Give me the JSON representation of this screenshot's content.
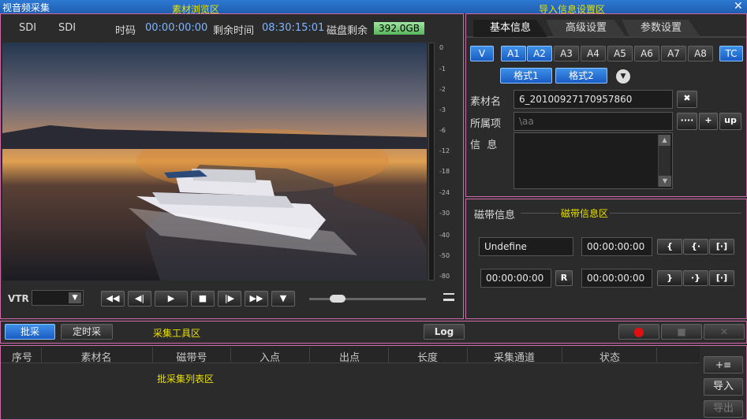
{
  "window": {
    "title": "视音频采集",
    "close_icon": "close-icon"
  },
  "zones": {
    "preview": "素材浏览区",
    "import": "导入信息设置区",
    "tape": "磁带信息区",
    "tools": "采集工具区",
    "list": "批采集列表区"
  },
  "status": {
    "sdi1": "SDI",
    "sdi2": "SDI",
    "timecode_label": "时码",
    "timecode": "00:00:00:00",
    "remain_label": "剩余时间",
    "remain": "08:30:15:01",
    "disk_label": "磁盘剩余",
    "disk": "392.0GB"
  },
  "audio_scale": [
    "0",
    "-1",
    "-2",
    "-3",
    "-6",
    "-12",
    "-18",
    "-24",
    "-30",
    "-40",
    "-50",
    "-80"
  ],
  "vtr": {
    "label": "VTR",
    "value": ""
  },
  "tabs": [
    "基本信息",
    "高级设置",
    "参数设置"
  ],
  "channels": {
    "v": "V",
    "a": [
      "A1",
      "A2",
      "A3",
      "A4",
      "A5",
      "A6",
      "A7",
      "A8"
    ],
    "tc": "TC"
  },
  "formats": [
    "格式1",
    "格式2"
  ],
  "form": {
    "material_label": "素材名",
    "material_value": "6_20100927170957860",
    "belong_label": "所属项",
    "belong_value": "\\aa",
    "info_label": "信  息",
    "more": "····",
    "plus": "+",
    "up": "up"
  },
  "tape": {
    "label": "磁带信息",
    "name": "Undefine",
    "tc1": "00:00:00:00",
    "tc2": "00:00:00:00",
    "tc3": "00:00:00:00",
    "r": "R"
  },
  "toolbar": {
    "batch": "批采",
    "timed": "定时采",
    "log": "Log"
  },
  "list": {
    "columns": [
      "序号",
      "素材名",
      "磁带号",
      "入点",
      "出点",
      "长度",
      "采集通道",
      "状态"
    ],
    "import": "导入",
    "export": "导出",
    "add": "+≡"
  }
}
